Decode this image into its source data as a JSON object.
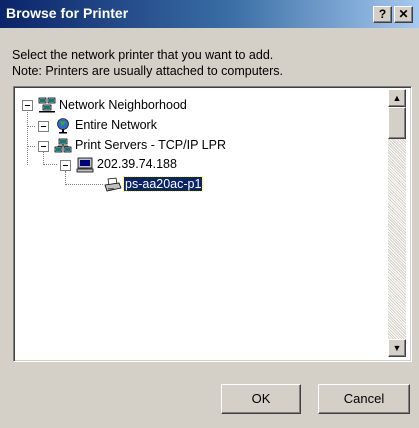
{
  "window": {
    "title": "Browse for Printer",
    "help_glyph": "?",
    "close_glyph": "✕"
  },
  "prompt": {
    "line1": "Select the network printer that you want to add.",
    "line2": "Note: Printers are usually attached to computers."
  },
  "tree": {
    "nodes": [
      {
        "label": "Network Neighborhood",
        "icon": "network-neighborhood-icon",
        "expanded": true
      },
      {
        "label": "Entire Network",
        "icon": "entire-network-globe-icon",
        "expanded": true
      },
      {
        "label": "Print Servers - TCP/IP LPR",
        "icon": "print-servers-icon",
        "expanded": true
      },
      {
        "label": "202.39.74.188",
        "icon": "computer-icon",
        "expanded": true
      },
      {
        "label": "ps-aa20ac-p1",
        "icon": "printer-icon",
        "selected": true
      }
    ]
  },
  "scrollbar": {
    "up_glyph": "▲",
    "down_glyph": "▼"
  },
  "buttons": {
    "ok": "OK",
    "cancel": "Cancel"
  },
  "colors": {
    "titlebar_start": "#0a246a",
    "titlebar_end": "#a6caf0",
    "face": "#d4d0c8",
    "selection": "#0a246a"
  }
}
